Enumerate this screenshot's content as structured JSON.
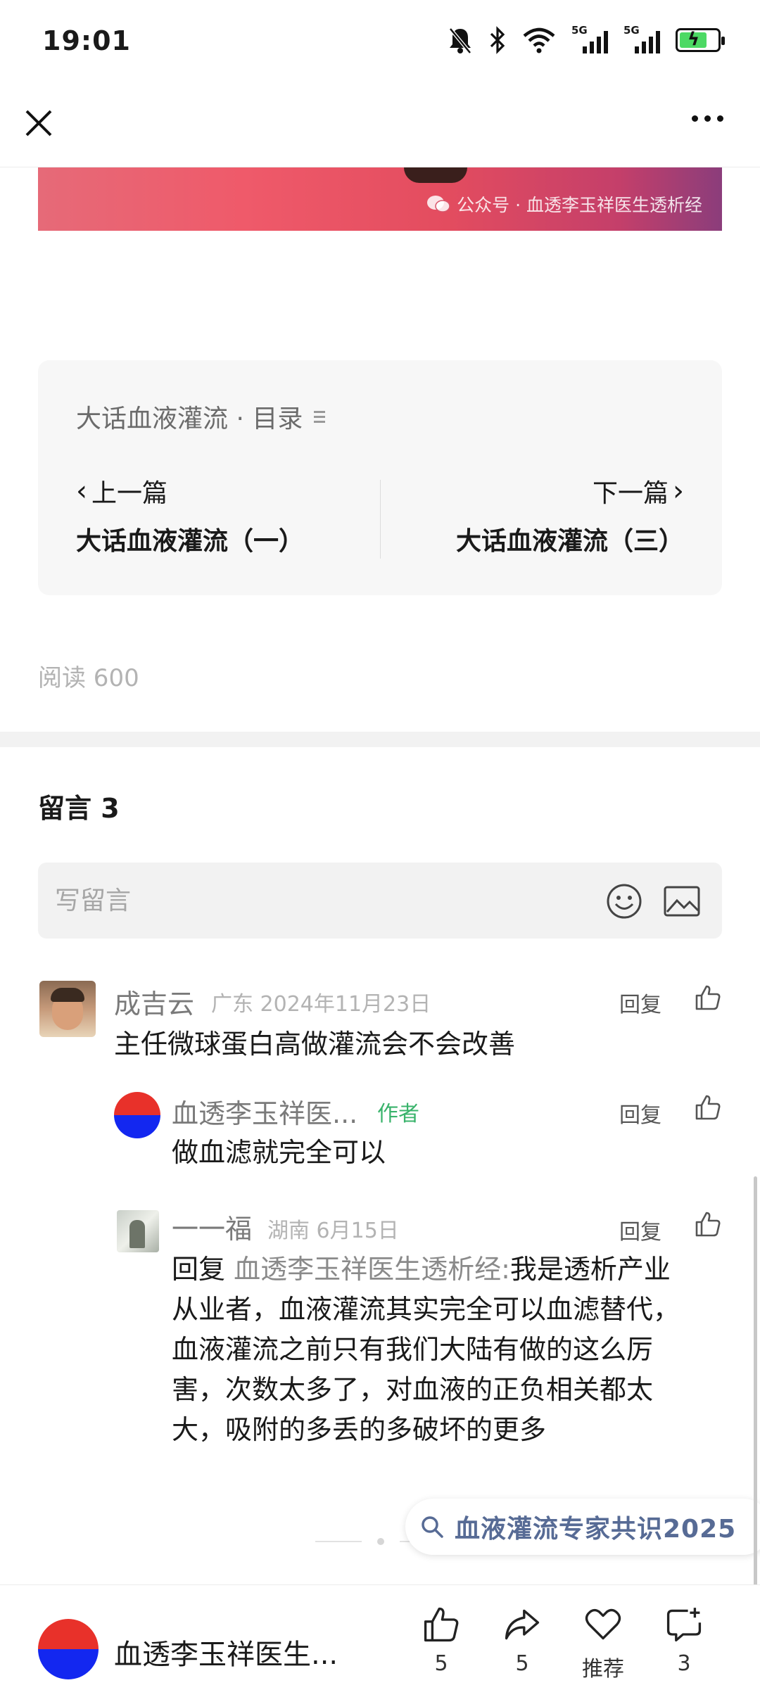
{
  "status_bar": {
    "time": "19:01",
    "signal1_label": "5G",
    "signal2_label": "5G"
  },
  "article": {
    "watermark": "公众号 · 血透李玉祥医生透析经",
    "directory": {
      "title": "大话血液灌流 · 目录",
      "prev_label": "上一篇",
      "prev_title": "大话血液灌流（一）",
      "next_label": "下一篇",
      "next_title": "大话血液灌流（三）"
    },
    "read_count_label": "阅读 600"
  },
  "comments_section": {
    "header": "留言 3",
    "input_placeholder": "写留言",
    "comments": [
      {
        "name": "成吉云",
        "meta": "广东 2024年11月23日",
        "text": "主任微球蛋白高做灌流会不会改善",
        "reply_label": "回复"
      },
      {
        "name": "血透李玉祥医...",
        "author_badge": "作者",
        "text": "做血滤就完全可以",
        "reply_label": "回复"
      },
      {
        "name": "一一福",
        "meta": "湖南 6月15日",
        "reply_prefix": "回复",
        "reply_to": "血透李玉祥医生透析经:",
        "text_lines": [
          "我是透析产业",
          "从业者，血液灌流其实完全可以血滤替代，",
          "血液灌流之前只有我们大陆有做的这么厉",
          "害，次数太多了，对血液的正负相关都太",
          "大，吸附的多丢的多破坏的更多"
        ],
        "reply_label": "回复"
      }
    ]
  },
  "search_chip": {
    "label": "血液灌流专家共识2025"
  },
  "bottom_bar": {
    "account_name": "血透李玉祥医生...",
    "like_count": "5",
    "share_count": "5",
    "recommend_label": "推荐",
    "comment_count": "3"
  },
  "colors": {
    "link_blue": "#576b95",
    "author_green": "#39b36b",
    "avatar_red": "#e8312a",
    "avatar_blue": "#1327f0"
  }
}
